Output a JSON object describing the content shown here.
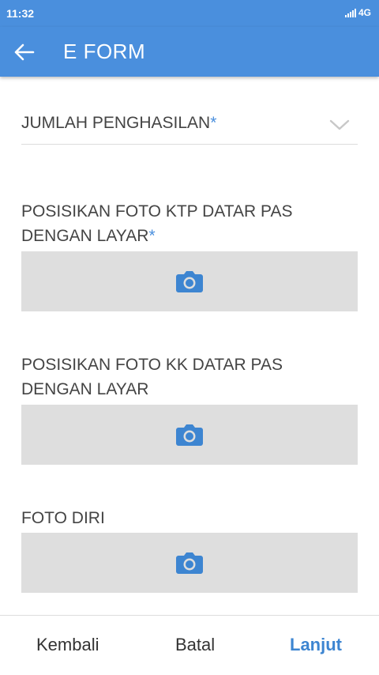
{
  "status": {
    "time": "11:32",
    "network": "4G"
  },
  "appbar": {
    "title": "E FORM",
    "back_icon": "arrow-left-icon"
  },
  "form": {
    "income": {
      "label": "JUMLAH PENGHASILAN",
      "required": "*"
    },
    "ktp_photo": {
      "label_line1": "POSISIKAN FOTO KTP DATAR PAS",
      "label_line2": "DENGAN LAYAR",
      "required": "*"
    },
    "kk_photo": {
      "label_line1": "POSISIKAN FOTO KK DATAR PAS",
      "label_line2": "DENGAN LAYAR"
    },
    "selfie": {
      "label": "FOTO DIRI"
    }
  },
  "footer": {
    "back_label": "Kembali",
    "cancel_label": "Batal",
    "next_label": "Lanjut"
  },
  "colors": {
    "accent": "#4a8fdd",
    "photo_box": "#dedede",
    "text": "#444444"
  }
}
